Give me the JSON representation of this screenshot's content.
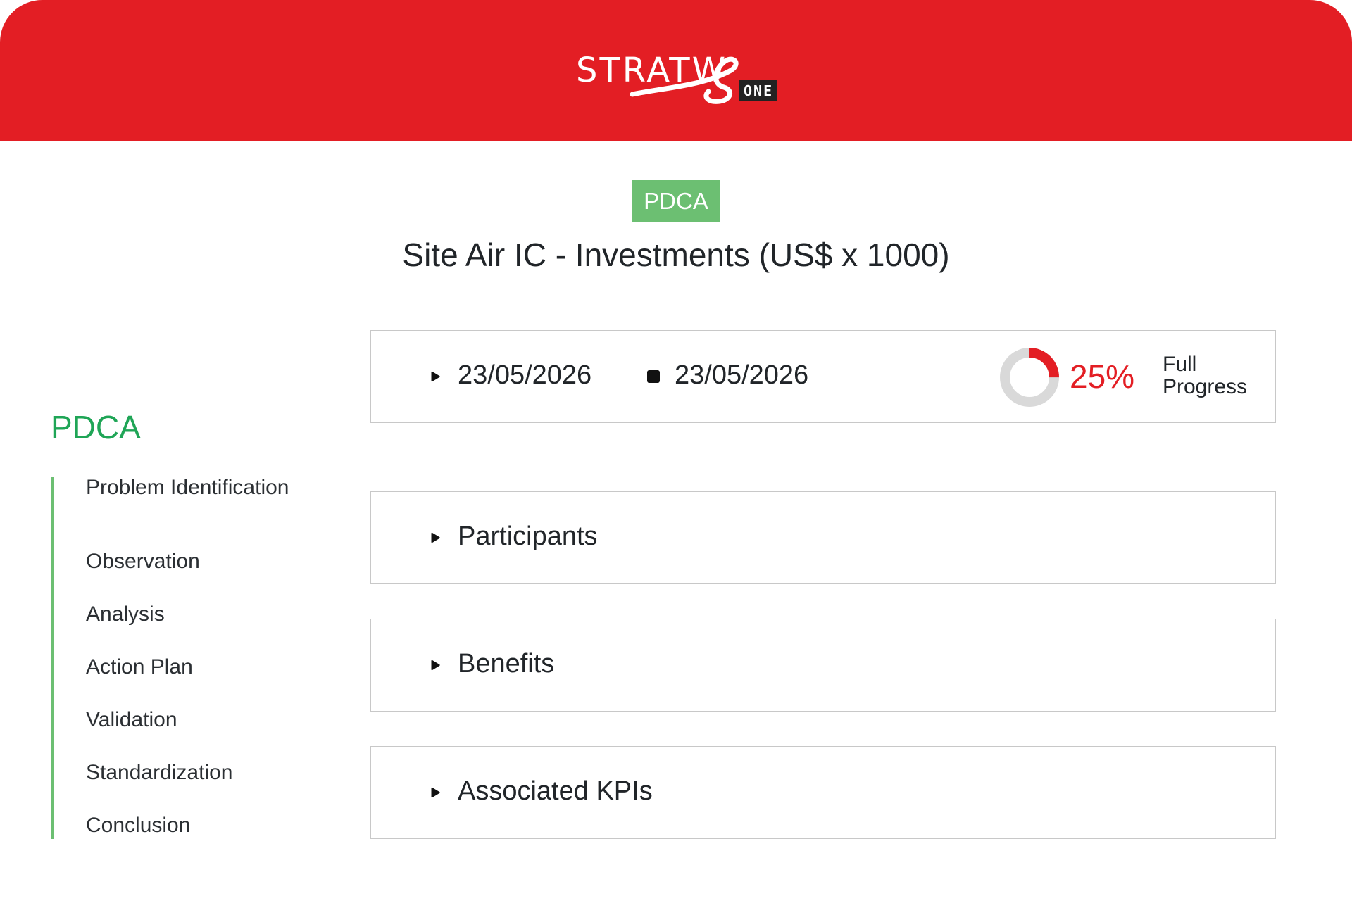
{
  "header": {
    "logo_text": "STRATW",
    "logo_badge": "ONE",
    "brand_color": "#e31e24",
    "logo_icon": "stratws-logo"
  },
  "pdca_tag": {
    "label": "PDCA",
    "color": "#6cbf72"
  },
  "page_title": "Site Air IC - Investments (US$ x 1000)",
  "sidebar": {
    "title": "PDCA",
    "title_color": "#1fa556",
    "items": [
      {
        "label": "Problem Identification"
      },
      {
        "label": "Observation"
      },
      {
        "label": "Analysis"
      },
      {
        "label": "Action Plan"
      },
      {
        "label": "Validation"
      },
      {
        "label": "Standardization"
      },
      {
        "label": "Conclusion"
      }
    ]
  },
  "dates_card": {
    "start_icon": "play-icon",
    "start_date": "23/05/2026",
    "end_icon": "stop-icon",
    "end_date": "23/05/2026",
    "progress_value": 0.25,
    "progress_text": "25%",
    "progress_label": "Full Progress",
    "progress_color": "#e31e24",
    "progress_track_color": "#d9d9d9"
  },
  "sections": [
    {
      "label": "Participants",
      "icon": "play-icon"
    },
    {
      "label": "Benefits",
      "icon": "play-icon"
    },
    {
      "label": "Associated KPIs",
      "icon": "play-icon"
    }
  ]
}
